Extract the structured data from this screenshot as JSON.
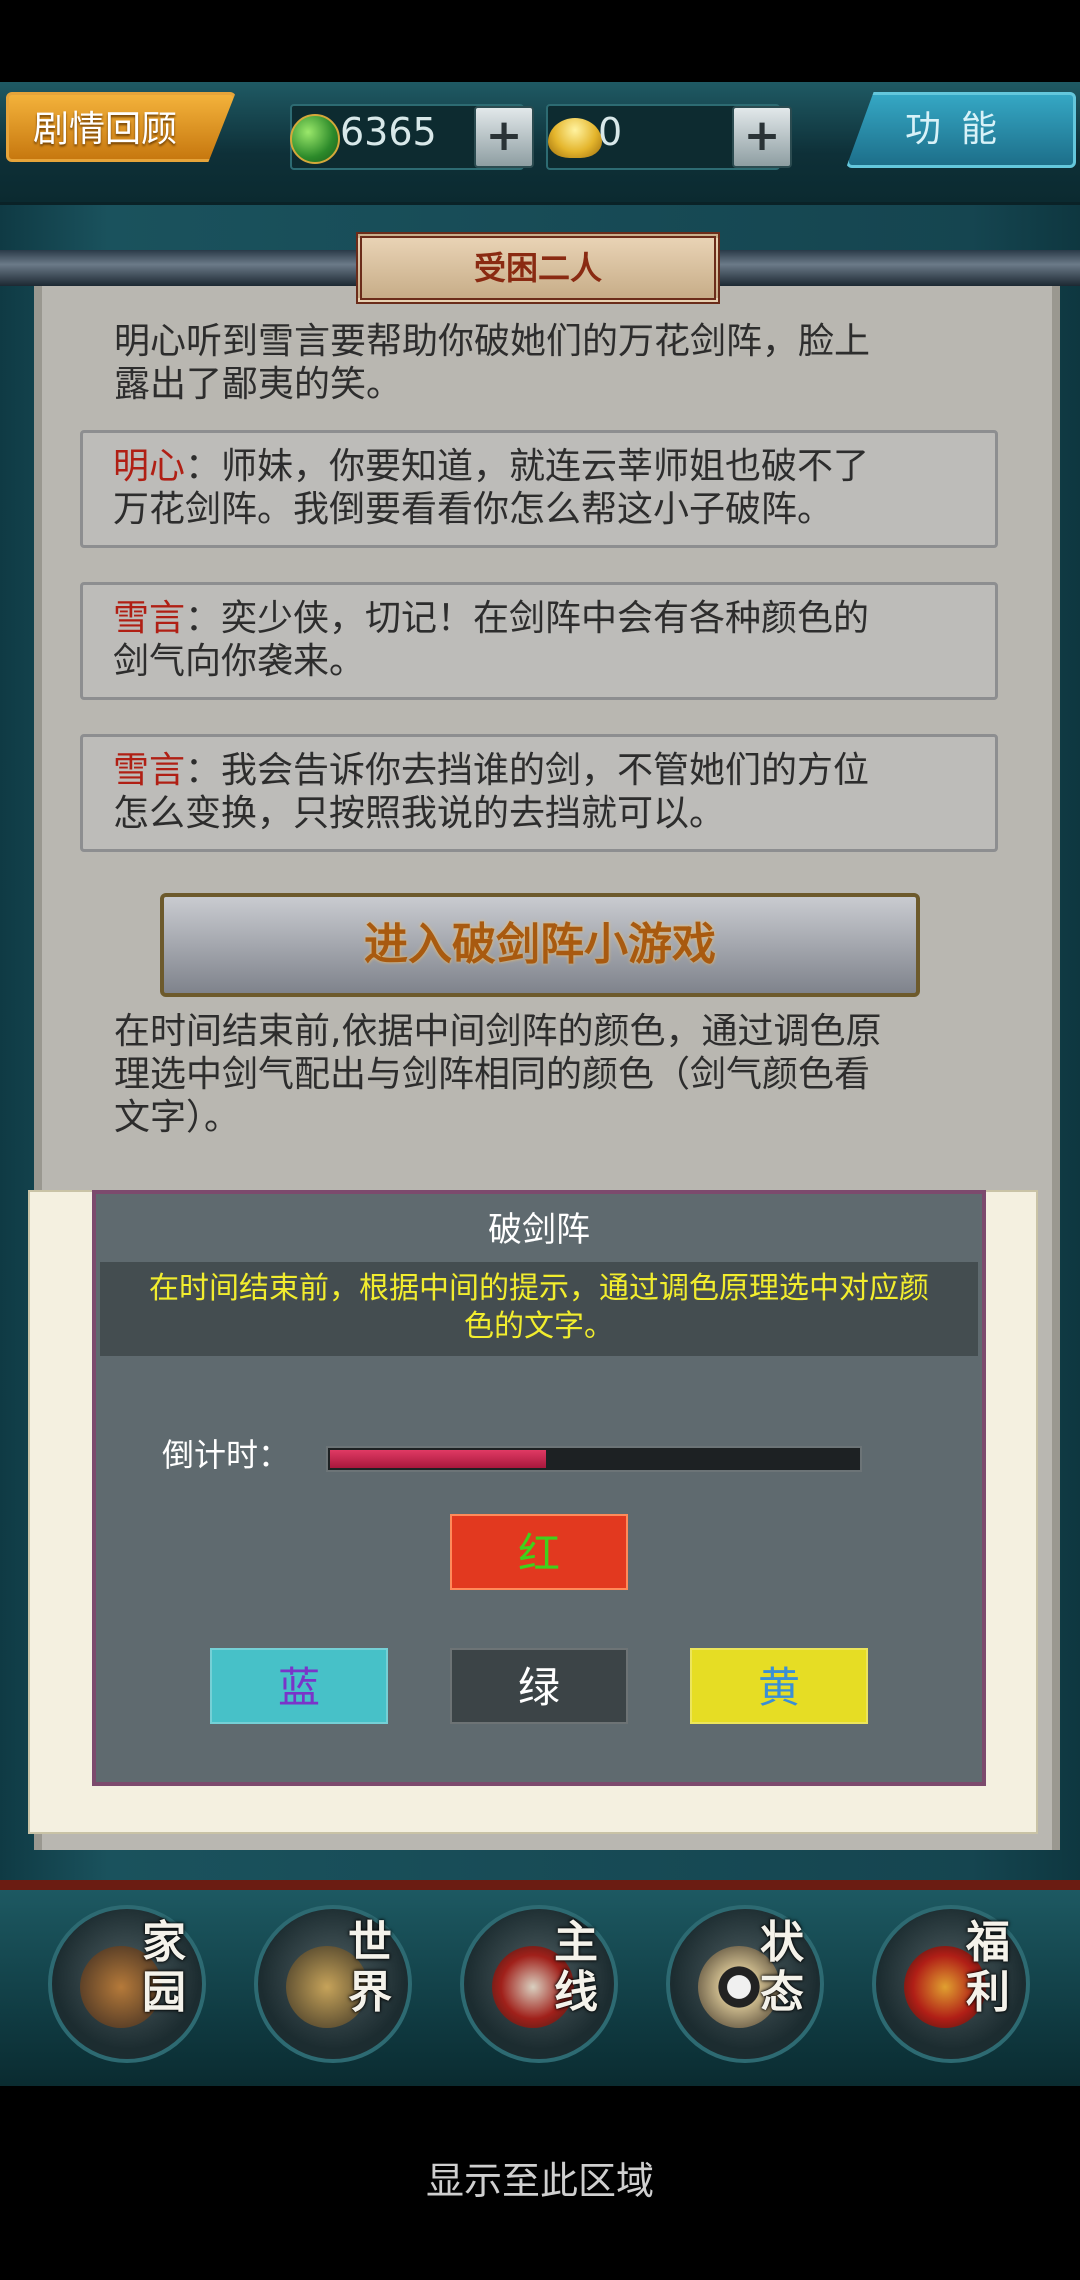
{
  "topbar": {
    "story_review": "剧情回顾",
    "coins": "6365",
    "ingots": "0",
    "plus": "+",
    "function_label": "功能"
  },
  "panel": {
    "title": "受困二人",
    "intro": [
      "明心听到雪言要帮助你破她们的万花剑阵，脸上",
      "露出了鄙夷的笑。"
    ],
    "dialogues": [
      {
        "speaker": "明心",
        "line1": "：师妹，你要知道，就连云莘师姐也破不了",
        "line2": "万花剑阵。我倒要看看你怎么帮这小子破阵。"
      },
      {
        "speaker": "雪言",
        "line1": "：奕少侠，切记！在剑阵中会有各种颜色的",
        "line2": "剑气向你袭来。"
      },
      {
        "speaker": "雪言",
        "line1": "：我会告诉你去挡谁的剑，不管她们的方位",
        "line2": "怎么变换，只按照我说的去挡就可以。"
      }
    ],
    "enter_button": "进入破剑阵小游戏",
    "rules": [
      "在时间结束前,依据中间剑阵的颜色，通过调色原",
      "理选中剑气配出与剑阵相同的颜色（剑气颜色看",
      "文字）。"
    ]
  },
  "dialog": {
    "title": "破剑阵",
    "desc_line1": "在时间结束前，根据中间的提示，通过调色原理选中对应颜",
    "desc_line2": "色的文字。",
    "countdown_label": "倒计时：",
    "countdown_progress": 0.41,
    "center_option": {
      "text": "红",
      "bg": "#e2391f",
      "fg": "#3fd11b"
    },
    "options": [
      {
        "text": "蓝",
        "bg": "#47c1c8",
        "fg": "#7a34c9"
      },
      {
        "text": "绿",
        "bg": "#3c4447",
        "fg": "#ffffff"
      },
      {
        "text": "黄",
        "bg": "#e6dd24",
        "fg": "#3a8fd6"
      }
    ]
  },
  "nav": [
    {
      "label": [
        "家",
        "园"
      ],
      "icon": "home-icon"
    },
    {
      "label": [
        "世",
        "界"
      ],
      "icon": "world-icon"
    },
    {
      "label": [
        "主",
        "线"
      ],
      "icon": "mainline-icon"
    },
    {
      "label": [
        "状",
        "态"
      ],
      "icon": "status-icon"
    },
    {
      "label": [
        "福",
        "利"
      ],
      "icon": "welfare-icon"
    }
  ],
  "bottom_hint": "显示至此区域"
}
